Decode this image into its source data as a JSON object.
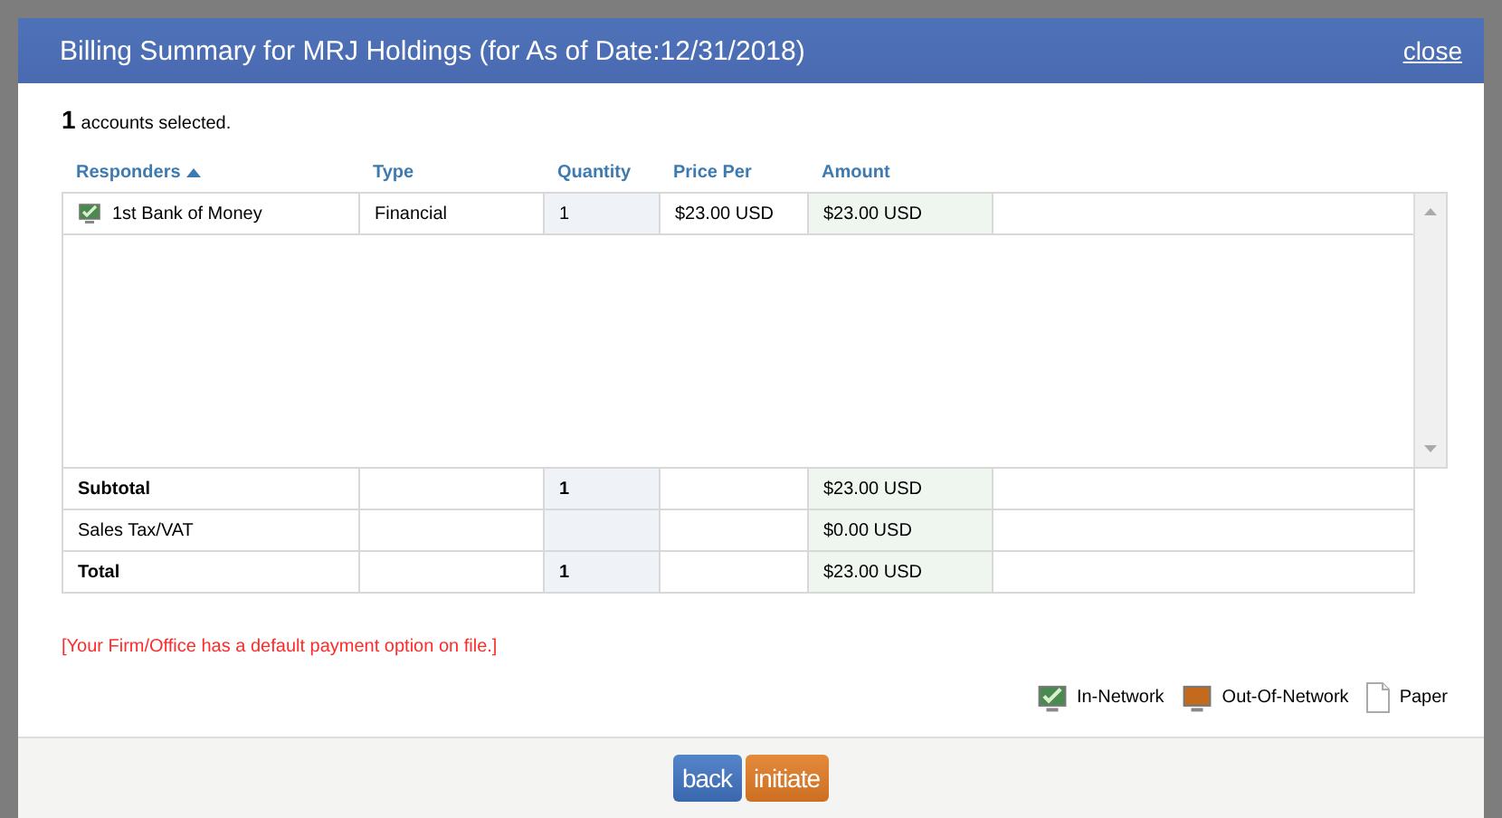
{
  "dialog": {
    "title": "Billing Summary for MRJ Holdings (for As of Date:12/31/2018)",
    "close": "close"
  },
  "selection": {
    "count": "1",
    "label": "accounts selected."
  },
  "table": {
    "columns": [
      "Responders",
      "Type",
      "Quantity",
      "Price Per",
      "Amount"
    ],
    "rows": [
      {
        "kind": "in-network",
        "responder": "1st Bank of Money",
        "type": "Financial",
        "quantity": "1",
        "price_per": "$23.00 USD",
        "amount": "$23.00 USD"
      }
    ]
  },
  "totals": [
    {
      "kind": "bold",
      "label": "Subtotal",
      "quantity": "1",
      "amount": "$23.00 USD"
    },
    {
      "kind": "plain",
      "label": "Sales Tax/VAT",
      "amount": "$0.00 USD"
    },
    {
      "kind": "bold",
      "label": "Total",
      "quantity": "1",
      "amount": "$23.00 USD"
    }
  ],
  "notice": "[Your Firm/Office has a default payment option on file.]",
  "legend": [
    {
      "kind": "in-network",
      "label": "In-Network"
    },
    {
      "kind": "out-of-network",
      "label": "Out-Of-Network"
    },
    {
      "kind": "paper",
      "label": "Paper"
    }
  ],
  "buttons": [
    {
      "kind": "back",
      "label": "back"
    },
    {
      "kind": "initiate",
      "label": "initiate"
    }
  ]
}
